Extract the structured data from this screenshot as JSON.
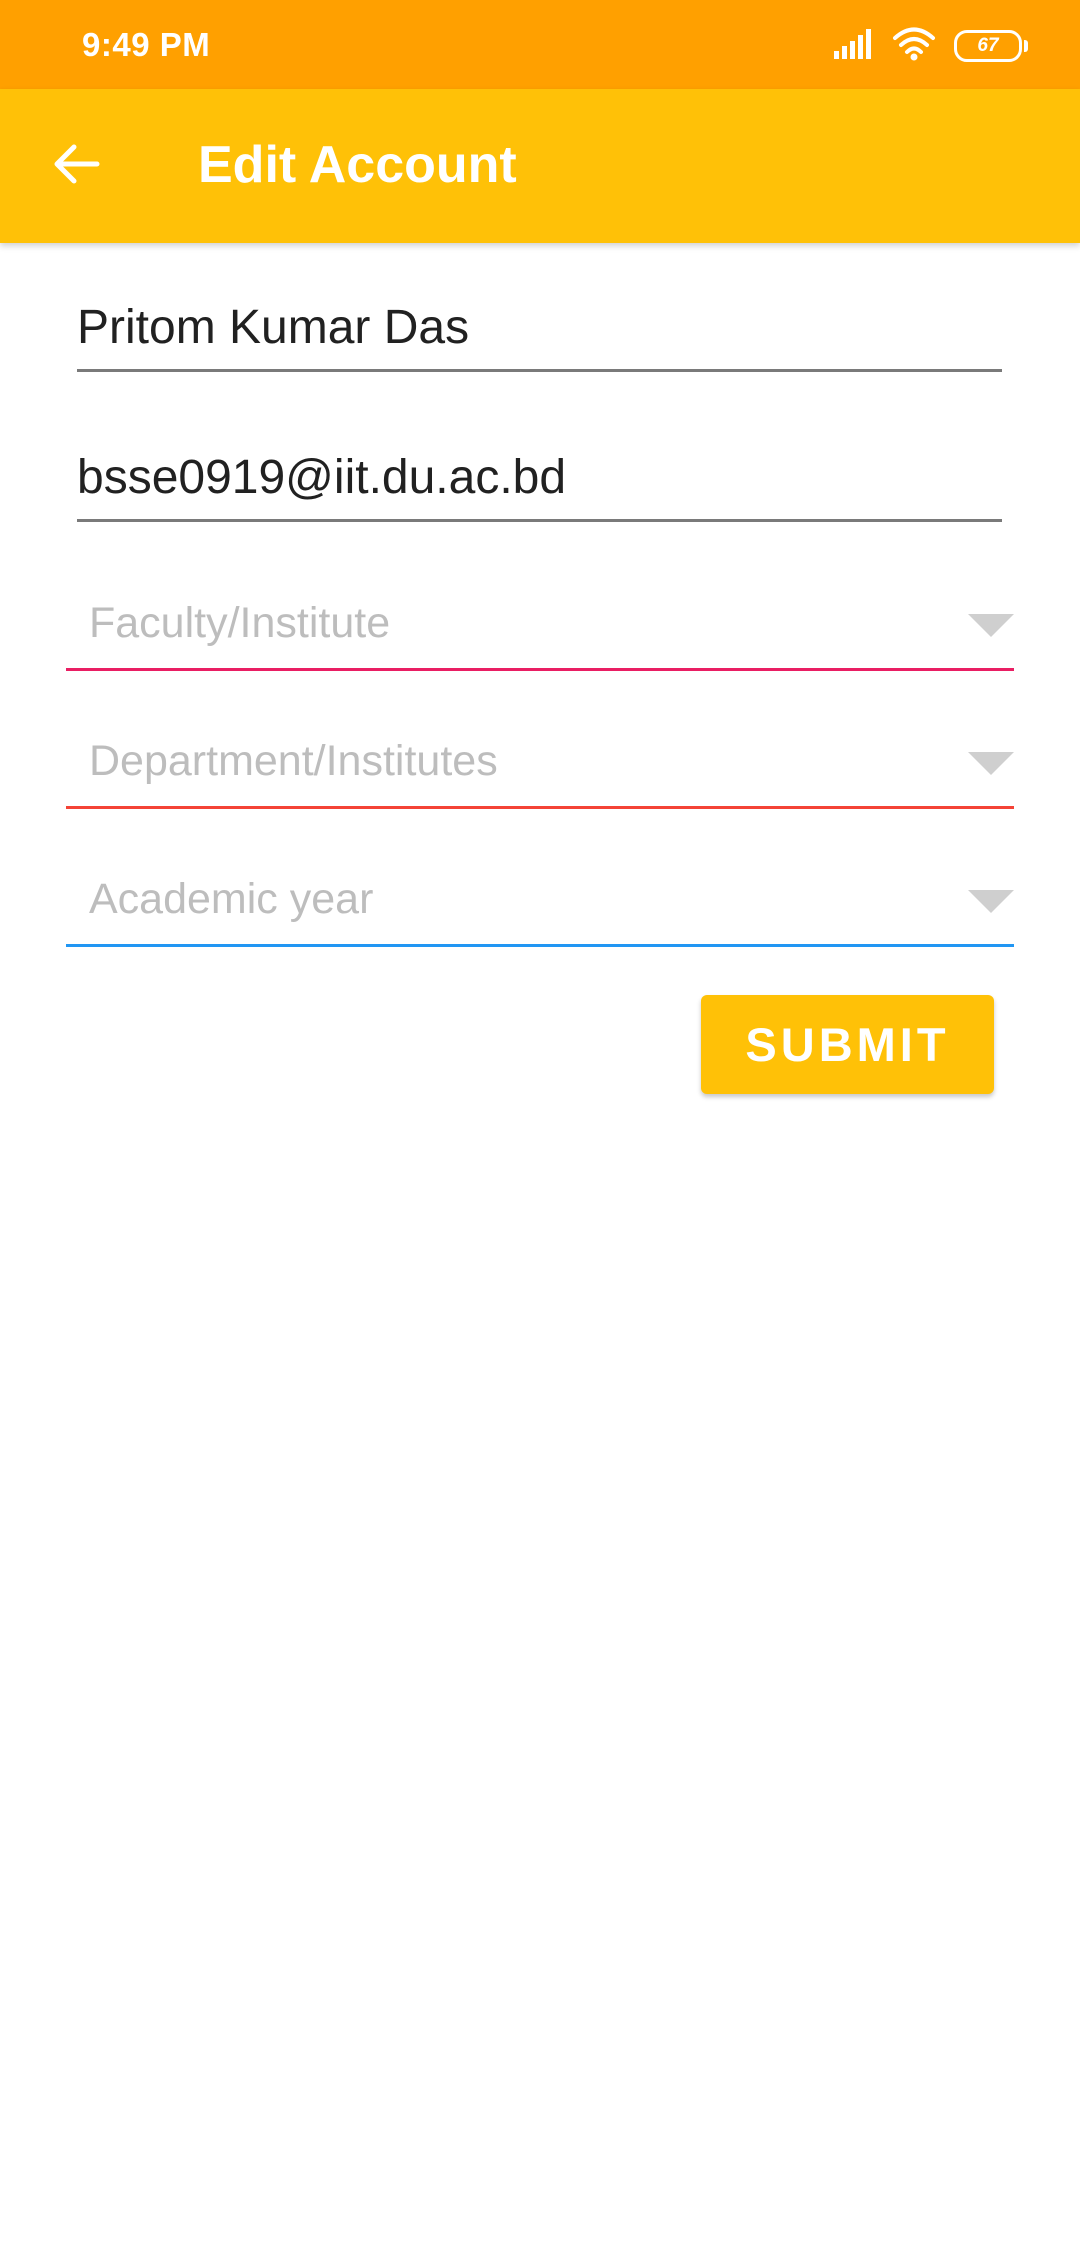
{
  "status_bar": {
    "time": "9:49 PM",
    "battery_level": "67",
    "icons": [
      "signal-icon",
      "wifi-icon",
      "battery-icon"
    ]
  },
  "app_bar": {
    "title": "Edit Account",
    "back_icon": "arrow-left-icon"
  },
  "form": {
    "name_value": "Pritom Kumar Das",
    "email_value": "bsse0919@iit.du.ac.bd",
    "faculty_placeholder": "Faculty/Institute",
    "department_placeholder": "Department/Institutes",
    "academic_year_placeholder": "Academic year",
    "submit_label": "SUBMIT"
  },
  "colors": {
    "status_bar": "#FFA000",
    "app_bar": "#FFC107",
    "faculty_underline": "#E91E63",
    "department_underline": "#F44336",
    "academic_year_underline": "#2196F3"
  }
}
